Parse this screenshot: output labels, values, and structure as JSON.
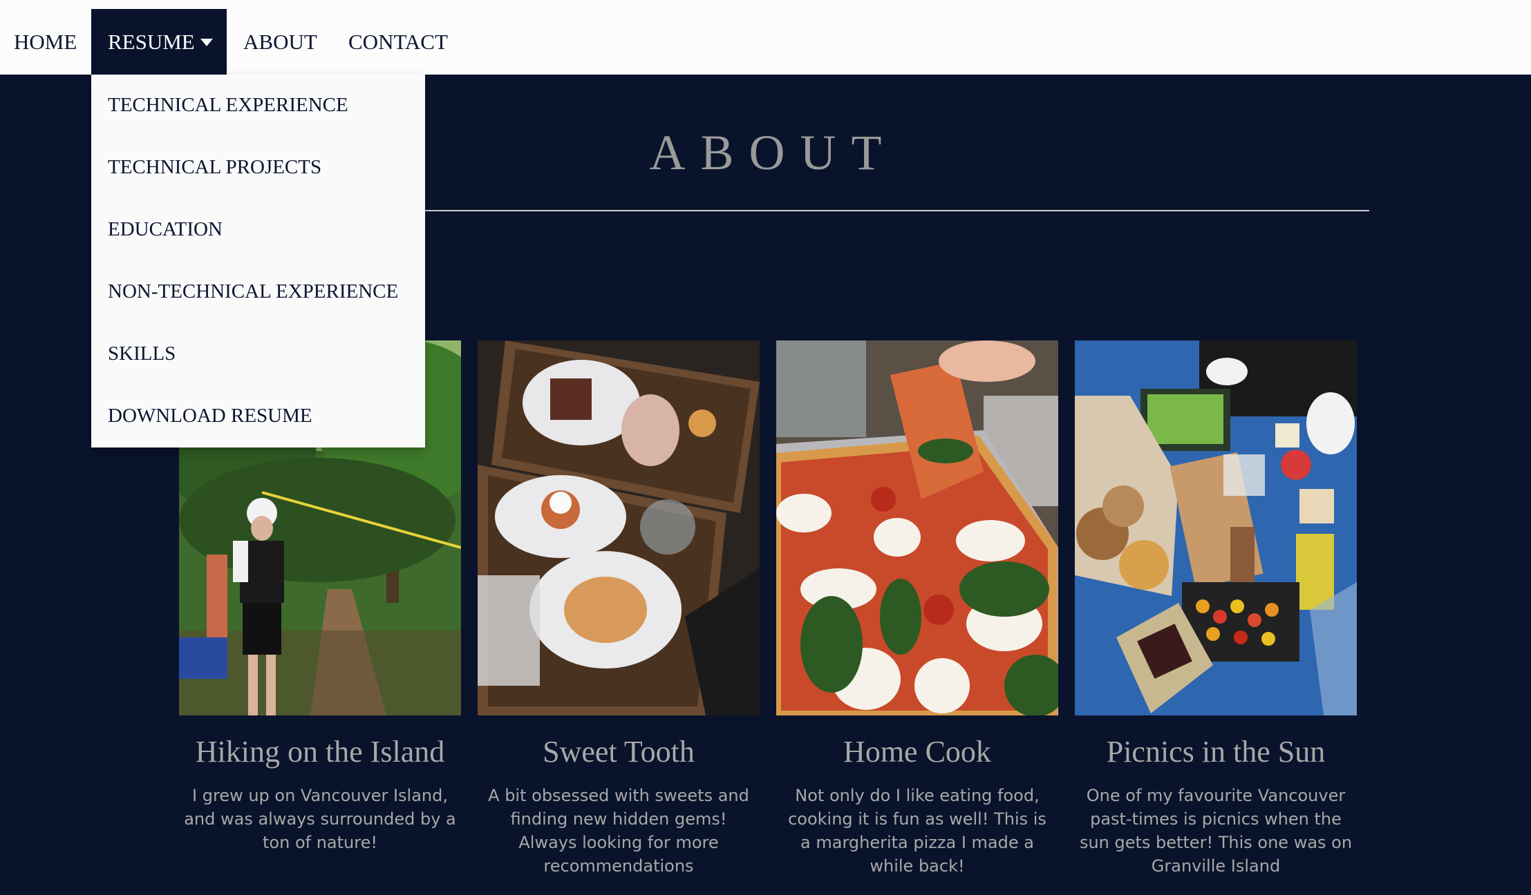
{
  "nav": {
    "home": "HOME",
    "resume": "RESUME",
    "about": "ABOUT",
    "contact": "CONTACT"
  },
  "dropdown": {
    "items": [
      "TECHNICAL EXPERIENCE",
      "TECHNICAL PROJECTS",
      "EDUCATION",
      "NON-TECHNICAL EXPERIENCE",
      "SKILLS",
      "DOWNLOAD RESUME"
    ]
  },
  "section": {
    "title": "ABOUT"
  },
  "cards": [
    {
      "title": "Hiking on the Island",
      "text": "I grew up on Vancouver Island, and was always surrounded by a ton of nature!"
    },
    {
      "title": "Sweet Tooth",
      "text": "A bit obsessed with sweets and finding new hidden gems! Always looking for more recommendations"
    },
    {
      "title": "Home Cook",
      "text": "Not only do I like eating food, cooking it is fun as well! This is a margherita pizza I made a while back!"
    },
    {
      "title": "Picnics in the Sun",
      "text": "One of my favourite Vancouver past-times is picnics when the sun gets better! This one was on Granville Island"
    }
  ],
  "colors": {
    "background": "#09132b",
    "navbar": "#fcfcfc",
    "active_nav": "#09132b",
    "muted_text": "#a8a8a8"
  }
}
